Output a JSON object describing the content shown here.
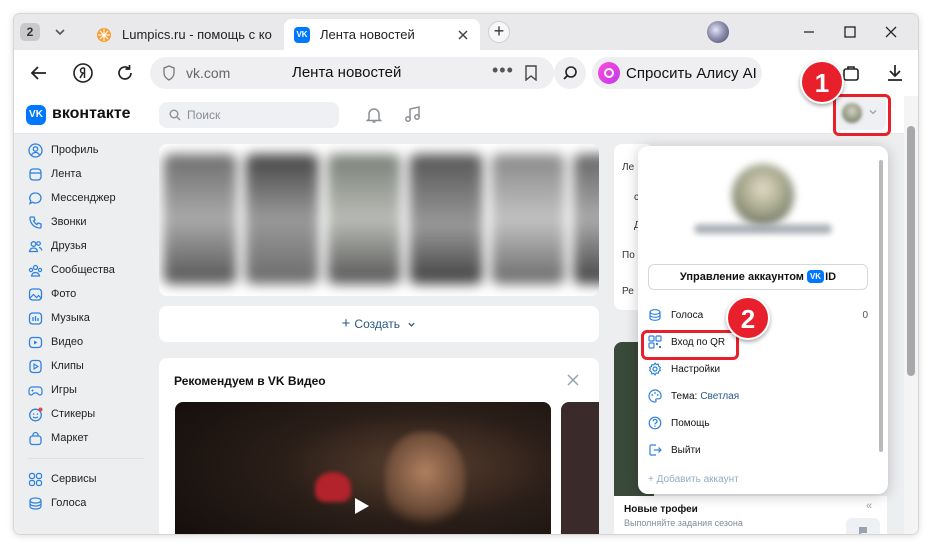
{
  "browser": {
    "tab_count": "2",
    "tabs": [
      {
        "title": "Lumpics.ru - помощь с компьютером",
        "active": false
      },
      {
        "title": "Лента новостей",
        "active": true
      }
    ],
    "address": {
      "domain": "vk.com",
      "page_title": "Лента новостей",
      "dots": "•••"
    },
    "alice_label": "Спросить Алису AI"
  },
  "vk": {
    "brand": "вконтакте",
    "search_placeholder": "Поиск",
    "nav": [
      {
        "label": "Профиль",
        "icon": "user-icon"
      },
      {
        "label": "Лента",
        "icon": "feed-icon"
      },
      {
        "label": "Мессенджер",
        "icon": "chat-icon"
      },
      {
        "label": "Звонки",
        "icon": "phone-icon"
      },
      {
        "label": "Друзья",
        "icon": "friends-icon"
      },
      {
        "label": "Сообщества",
        "icon": "communities-icon"
      },
      {
        "label": "Фото",
        "icon": "photo-icon"
      },
      {
        "label": "Музыка",
        "icon": "music-icon"
      },
      {
        "label": "Видео",
        "icon": "video-icon"
      },
      {
        "label": "Клипы",
        "icon": "clips-icon"
      },
      {
        "label": "Игры",
        "icon": "gamepad-icon"
      },
      {
        "label": "Стикеры",
        "icon": "sticker-icon"
      },
      {
        "label": "Маркет",
        "icon": "bag-icon"
      }
    ],
    "nav_extra": [
      {
        "label": "Сервисы",
        "icon": "services-icon"
      },
      {
        "label": "Голоса",
        "icon": "votes-icon"
      }
    ],
    "create_label": "Создать",
    "recommend": {
      "title": "Рекомендуем в VK Видео"
    },
    "right_menu": [
      "Ле",
      "с",
      "Д",
      "По",
      "Ре"
    ],
    "trophy": {
      "title": "Новые трофеи",
      "subtitle": "Выполняйте задания сезона"
    },
    "dropdown": {
      "manage_label": "Управление аккаунтом",
      "vk_badge": "VK",
      "id_label": "ID",
      "items": [
        {
          "label": "Голоса",
          "value": "0",
          "icon": "votes-icon"
        },
        {
          "label": "Вход по QR",
          "value": "",
          "icon": "qr-icon"
        },
        {
          "label": "Настройки",
          "value": "",
          "icon": "gear-icon"
        },
        {
          "label": "Тема:",
          "accent": "Светлая",
          "icon": "palette-icon"
        },
        {
          "label": "Помощь",
          "value": "",
          "icon": "help-icon"
        },
        {
          "label": "Выйти",
          "value": "",
          "icon": "logout-icon"
        }
      ],
      "add_account": "Добавить аккаунт"
    }
  },
  "annotations": {
    "step1": "1",
    "step2": "2",
    "color": "#e8202b"
  }
}
